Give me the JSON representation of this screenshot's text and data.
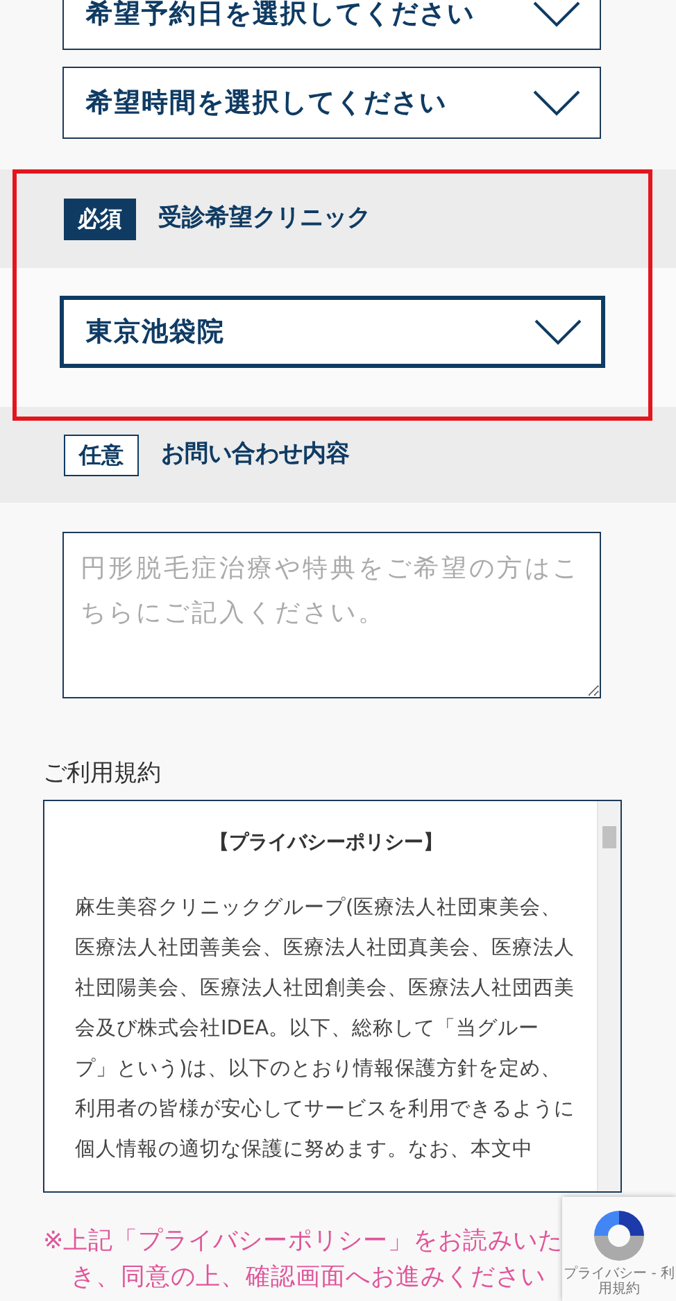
{
  "date_select": {
    "value": "希望予約日を選択してください"
  },
  "time_select": {
    "value": "希望時間を選択してください"
  },
  "clinic_section": {
    "badge": "必須",
    "required": true,
    "label": "受診希望クリニック",
    "select": {
      "value": "東京池袋院",
      "focused": true
    },
    "highlighted": true
  },
  "inquiry_section": {
    "badge": "任意",
    "required": false,
    "label": "お問い合わせ内容",
    "textarea": {
      "placeholder": "円形脱毛症治療や特典をご希望の方はこちらにご記入ください。"
    }
  },
  "terms": {
    "label": "ご利用規約",
    "title": "【プライバシーポリシー】",
    "body": "麻生美容クリニックグループ(医療法人社団東美会、医療法人社団善美会、医療法人社団真美会、医療法人社団陽美会、医療法人社団創美会、医療法人社団西美会及び株式会社IDEA。以下、総称して「当グループ」という)は、以下のとおり情報保護方針を定め、利用者の皆様が安心してサービスを利用できるように個人情報の適切な保護に努めます。なお、本文中"
  },
  "notice": [
    "※上記「プライバシーポリシー」をお読みいた",
    "き、同意の上、確認画面へお進みください"
  ],
  "recaptcha": {
    "text": "プライバシー - 利用規約"
  }
}
